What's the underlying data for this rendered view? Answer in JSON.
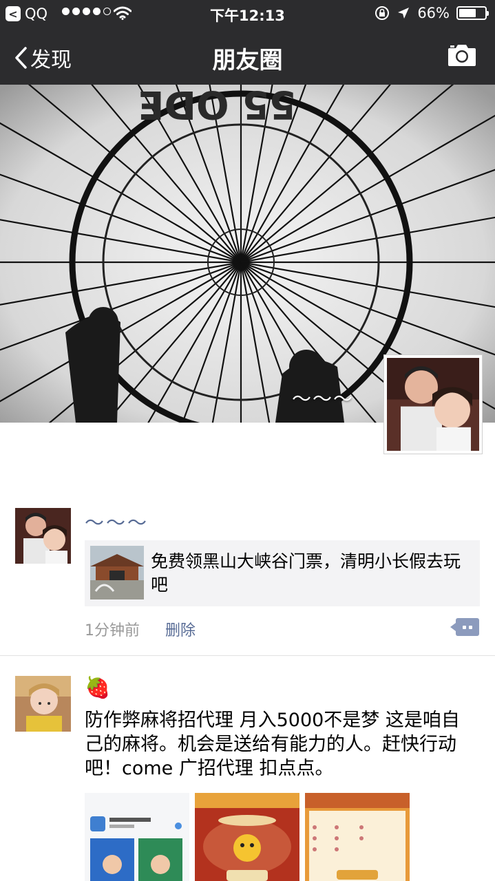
{
  "status_bar": {
    "back_app": "QQ",
    "time": "下午12:13",
    "battery": "66%",
    "battery_level": 0.66
  },
  "nav": {
    "back_label": "发现",
    "title": "朋友圈"
  },
  "profile": {
    "nickname": "～～～"
  },
  "posts": [
    {
      "name": "～～～",
      "share_title": "免费领黑山大峡谷门票，清明小长假去玩吧",
      "time": "1分钟前",
      "delete_label": "删除"
    },
    {
      "name": "🍓",
      "text": "防作弊麻将招代理 月入5000不是梦  这是咱自己的麻将。机会是送给有能力的人。赶快行动吧！come  广招代理 扣点点。"
    }
  ],
  "colors": {
    "bar_bg": "#2c2c2e",
    "link": "#576b95",
    "card_bg": "#f3f3f5",
    "meta": "#9a9a9a"
  }
}
